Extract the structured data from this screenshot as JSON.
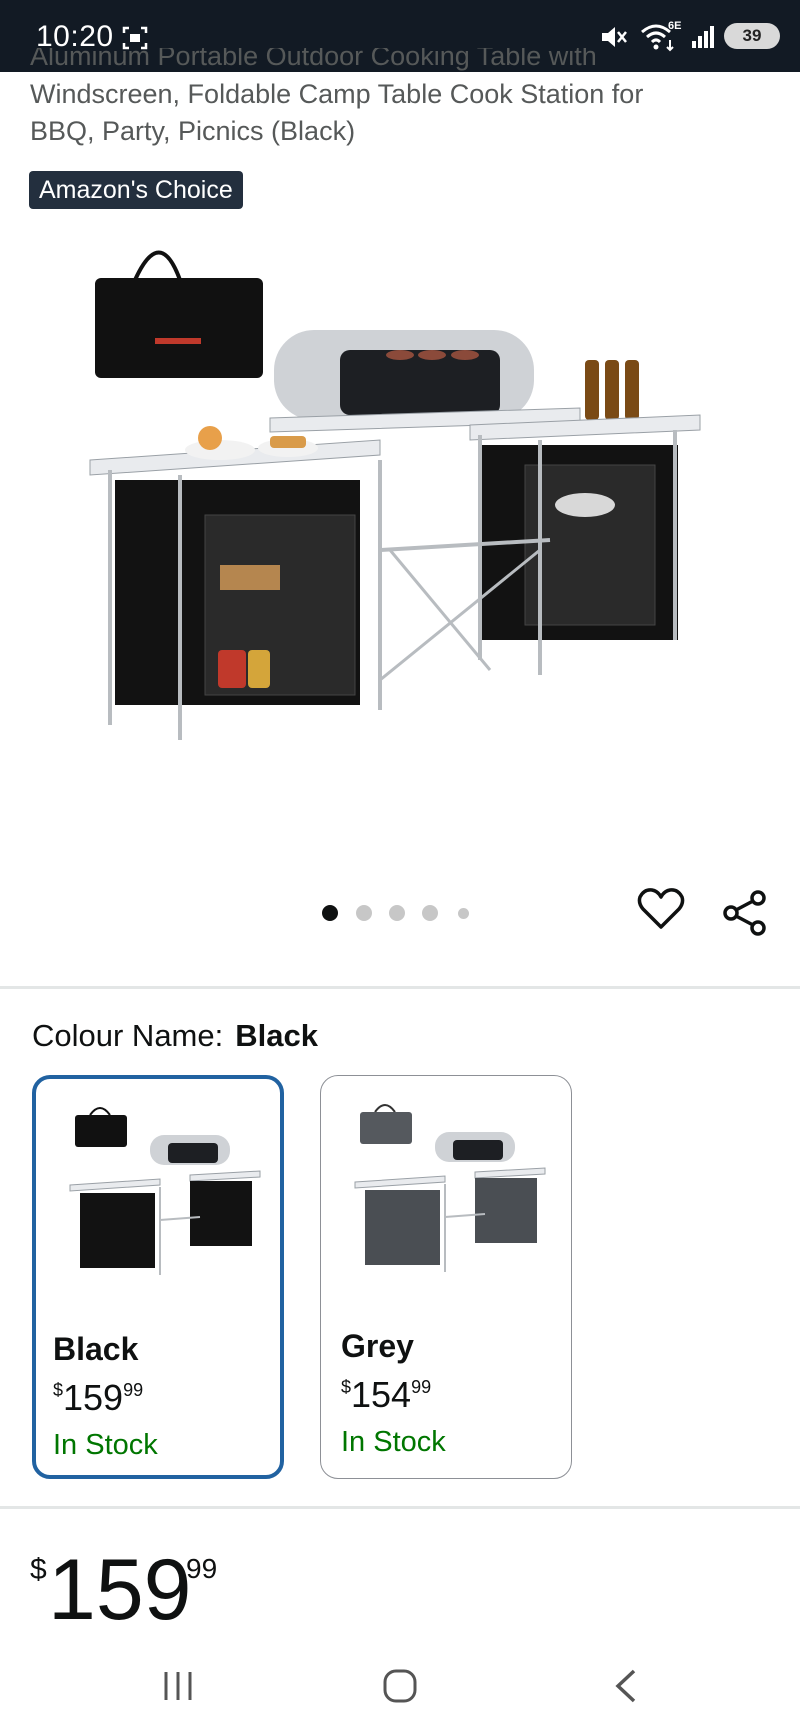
{
  "status_bar": {
    "time": "10:20",
    "wifi_label": "6E",
    "battery": "39"
  },
  "product": {
    "title_partial": "Aluminum Portable Outdoor Cooking Table with",
    "title_line2": "Windscreen, Foldable Camp Table Cook Station for",
    "title_line3": "BBQ, Party, Picnics (Black)",
    "badge": "Amazon's Choice"
  },
  "carousel": {
    "total": 5,
    "active": 1
  },
  "actions": {
    "wishlist_icon": "heart-icon",
    "share_icon": "share-icon"
  },
  "colour": {
    "label": "Colour Name:",
    "selected": "Black",
    "options": [
      {
        "name": "Black",
        "currency": "$",
        "whole": "159",
        "fraction": "99",
        "stock": "In Stock"
      },
      {
        "name": "Grey",
        "currency": "$",
        "whole": "154",
        "fraction": "99",
        "stock": "In Stock"
      }
    ]
  },
  "price": {
    "currency": "$",
    "whole": "159",
    "fraction": "99"
  },
  "colors": {
    "status_bar_bg": "#121a24",
    "badge_bg": "#232f3e",
    "selected_border": "#2162a1",
    "in_stock": "#007600"
  }
}
